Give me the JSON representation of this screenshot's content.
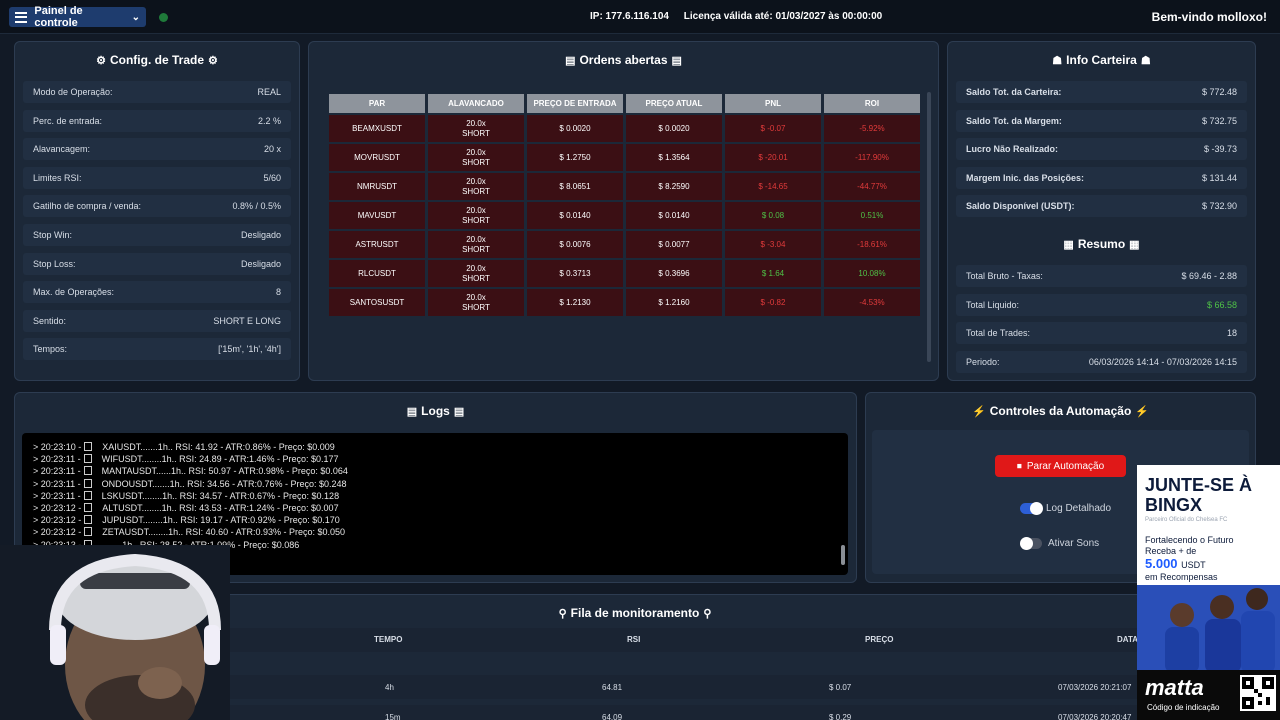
{
  "topbar": {
    "menu_label": "Painel de controle",
    "ip": "IP: 177.6.116.104",
    "license": "Licença válida até: 01/03/2027 às 00:00:00",
    "welcome": "Bem-vindo molloxo!",
    "status_color": "#1f7a3a"
  },
  "config": {
    "title": "Config. de Trade",
    "rows": [
      {
        "label": "Modo de Operação:",
        "value": "REAL"
      },
      {
        "label": "Perc. de entrada:",
        "value": "2.2 %"
      },
      {
        "label": "Alavancagem:",
        "value": "20 x"
      },
      {
        "label": "Limites RSI:",
        "value": "5/60"
      },
      {
        "label": "Gatilho de compra / venda:",
        "value": "0.8% / 0.5%"
      },
      {
        "label": "Stop Win:",
        "value": "Desligado"
      },
      {
        "label": "Stop Loss:",
        "value": "Desligado"
      },
      {
        "label": "Max. de Operações:",
        "value": "8"
      },
      {
        "label": "Sentido:",
        "value": "SHORT E LONG"
      },
      {
        "label": "Tempos:",
        "value": "['15m', '1h', '4h']"
      }
    ]
  },
  "orders": {
    "title": "Ordens abertas",
    "headers": [
      "PAR",
      "ALAVANCADO",
      "PREÇO DE ENTRADA",
      "PREÇO ATUAL",
      "PNL",
      "ROI"
    ],
    "rows": [
      {
        "par": "BEAMXUSDT",
        "lev": "20.0x",
        "side": "SHORT",
        "entry": "$ 0.0020",
        "current": "$ 0.0020",
        "pnl": "$ -0.07",
        "roi": "-5.92%",
        "sign": "neg"
      },
      {
        "par": "MOVRUSDT",
        "lev": "20.0x",
        "side": "SHORT",
        "entry": "$ 1.2750",
        "current": "$ 1.3564",
        "pnl": "$ -20.01",
        "roi": "-117.90%",
        "sign": "neg"
      },
      {
        "par": "NMRUSDT",
        "lev": "20.0x",
        "side": "SHORT",
        "entry": "$ 8.0651",
        "current": "$ 8.2590",
        "pnl": "$ -14.65",
        "roi": "-44.77%",
        "sign": "neg"
      },
      {
        "par": "MAVUSDT",
        "lev": "20.0x",
        "side": "SHORT",
        "entry": "$ 0.0140",
        "current": "$ 0.0140",
        "pnl": "$ 0.08",
        "roi": "0.51%",
        "sign": "pos"
      },
      {
        "par": "ASTRUSDT",
        "lev": "20.0x",
        "side": "SHORT",
        "entry": "$ 0.0076",
        "current": "$ 0.0077",
        "pnl": "$ -3.04",
        "roi": "-18.61%",
        "sign": "neg"
      },
      {
        "par": "RLCUSDT",
        "lev": "20.0x",
        "side": "SHORT",
        "entry": "$ 0.3713",
        "current": "$ 0.3696",
        "pnl": "$ 1.64",
        "roi": "10.08%",
        "sign": "pos"
      },
      {
        "par": "SANTOSUSDT",
        "lev": "20.0x",
        "side": "SHORT",
        "entry": "$ 1.2130",
        "current": "$ 1.2160",
        "pnl": "$ -0.82",
        "roi": "-4.53%",
        "sign": "neg"
      }
    ]
  },
  "wallet": {
    "title": "Info Carteira",
    "rows": [
      {
        "label": "Saldo Tot. da Carteira:",
        "value": "$ 772.48"
      },
      {
        "label": "Saldo Tot. da Margem:",
        "value": "$ 732.75"
      },
      {
        "label": "Lucro Não Realizado:",
        "value": "$ -39.73"
      },
      {
        "label": "Margem Inic. das Posições:",
        "value": "$ 131.44"
      },
      {
        "label": "Saldo Disponível (USDT):",
        "value": "$ 732.90"
      }
    ]
  },
  "summary": {
    "title": "Resumo",
    "rows": [
      {
        "label": "Total Bruto - Taxas:",
        "value": "$ 69.46 - 2.88"
      },
      {
        "label": "Total Liquido:",
        "value": "$ 66.58"
      },
      {
        "label": "Total de Trades:",
        "value": "18"
      },
      {
        "label": "Periodo:",
        "value": "06/03/2026 14:14 - 07/03/2026 14:15"
      }
    ]
  },
  "logs": {
    "title": "Logs",
    "lines": [
      {
        "ts": "> 20:23:10 -",
        "text": "XAIUSDT.......1h.. RSI: 41.92 - ATR:0.86% - Preço: $0.009"
      },
      {
        "ts": "> 20:23:11 -",
        "text": "WIFUSDT........1h.. RSI: 24.89 - ATR:1.46% - Preço: $0.177"
      },
      {
        "ts": "> 20:23:11 -",
        "text": "MANTAUSDT......1h.. RSI: 50.97 - ATR:0.98% - Preço: $0.064"
      },
      {
        "ts": "> 20:23:11 -",
        "text": "ONDOUSDT.......1h.. RSI: 34.56 - ATR:0.76% - Preço: $0.248"
      },
      {
        "ts": "> 20:23:11 -",
        "text": "LSKUSDT........1h.. RSI: 34.57 - ATR:0.67% - Preço: $0.128"
      },
      {
        "ts": "> 20:23:12 -",
        "text": "ALTUSDT........1h.. RSI: 43.53 - ATR:1.24% - Preço: $0.007"
      },
      {
        "ts": "> 20:23:12 -",
        "text": "JUPUSDT........1h.. RSI: 19.17 - ATR:0.92% - Preço: $0.170"
      },
      {
        "ts": "> 20:23:12 -",
        "text": "ZETAUSDT........1h.. RSI: 40.60 - ATR:0.93% - Preço: $0.050"
      },
      {
        "ts": "> 20:23:13 -",
        "text": "........1h.. RSI: 28.52 - ATR:1.09% - Preço: $0.086"
      }
    ]
  },
  "automation": {
    "title": "Controles da Automação",
    "stop_label": "Parar Automação",
    "log_detail_label": "Log Detalhado",
    "sounds_label": "Ativar Sons",
    "log_detail_on": true,
    "sounds_on": false
  },
  "queue": {
    "title": "Fila de monitoramento",
    "headers": [
      "TEMPO",
      "RSI",
      "PREÇO",
      "DATA"
    ],
    "rows": [
      {
        "tempo": "4h",
        "rsi": "64.81",
        "preco": "$ 0.07",
        "data": "07/03/2026 20:21:07"
      },
      {
        "tempo": "15m",
        "rsi": "64.09",
        "preco": "$ 0.29",
        "data": "07/03/2026 20:20:47"
      }
    ]
  },
  "ad": {
    "headline": "JUNTE-SE À BINGX",
    "sub": "Parceiro Oficial do Chelsea FC",
    "line1": "Fortalecendo o Futuro",
    "line2": "Receba + de",
    "amount": "5.000",
    "currency": "USDT",
    "line3": "em Recompensas",
    "brand": "matta",
    "code": "Código de indicação"
  }
}
